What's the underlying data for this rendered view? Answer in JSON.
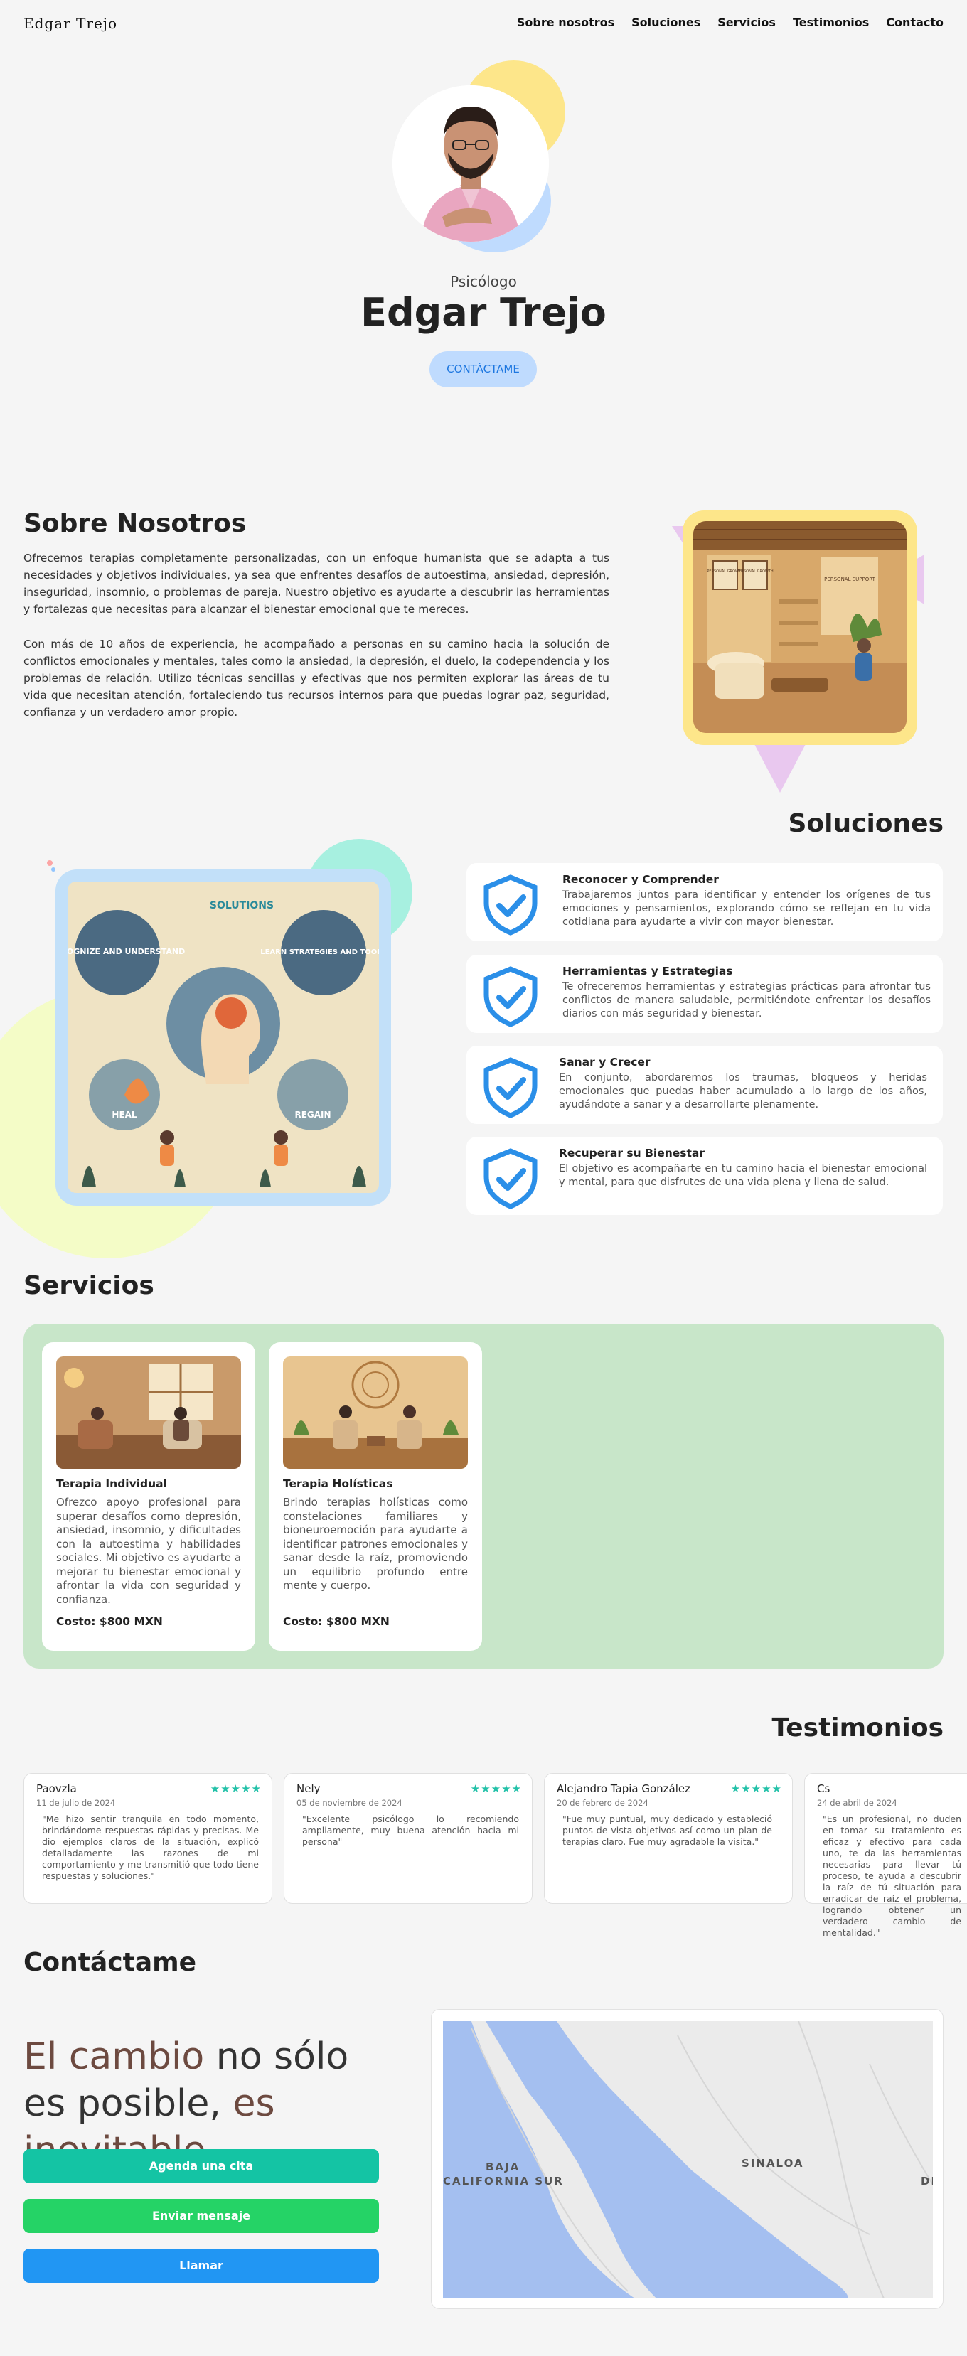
{
  "nav": {
    "brand": "Edgar Trejo",
    "links": [
      "Sobre nosotros",
      "Soluciones",
      "Servicios",
      "Testimonios",
      "Contacto"
    ]
  },
  "hero": {
    "role": "Psicólogo",
    "name": "Edgar Trejo",
    "cta": "CONTÁCTAME"
  },
  "about": {
    "title": "Sobre Nosotros",
    "p1": "Ofrecemos terapias completamente personalizadas, con un enfoque humanista que se adapta a tus necesidades y objetivos individuales, ya sea que enfrentes desafíos de autoestima, ansiedad, depresión, inseguridad, insomnio, o problemas de pareja. Nuestro objetivo es ayudarte a descubrir las herramientas y fortalezas que necesitas para alcanzar el bienestar emocional que te mereces.",
    "p2": "Con más de 10 años de experiencia, he acompañado a personas en su camino hacia la solución de conflictos emocionales y mentales, tales como la ansiedad, la depresión, el duelo, la codependencia y los problemas de relación. Utilizo técnicas sencillas y efectivas que nos permiten explorar las áreas de tu vida que necesitan atención, fortaleciendo tus recursos internos para que puedas lograr paz, seguridad, confianza y un verdadero amor propio.",
    "image_signs": [
      "PERSONAL GROWTH",
      "PERSONAL GROWTH",
      "PERSONAL SUPPORT"
    ]
  },
  "solutions": {
    "title": "Soluciones",
    "image_labels": {
      "top": "SOLUTIONS",
      "left": "RECOGNIZE AND UNDERSTAND",
      "right": "LEARN STRATEGIES AND TOOLS",
      "heal": "HEAL",
      "regain": "REGAIN"
    },
    "items": [
      {
        "title": "Reconocer y Comprender",
        "desc": "Trabajaremos juntos para identificar y entender los orígenes de tus emociones y pensamientos, explorando cómo se reflejan en tu vida cotidiana para ayudarte a vivir con mayor bienestar."
      },
      {
        "title": "Herramientas y Estrategias",
        "desc": "Te ofreceremos herramientas y estrategias prácticas para afrontar tus conflictos de manera saludable, permitiéndote enfrentar los desafíos diarios con más seguridad y bienestar."
      },
      {
        "title": "Sanar y Crecer",
        "desc": "En conjunto, abordaremos los traumas, bloqueos y heridas emocionales que puedas haber acumulado a lo largo de los años, ayudándote a sanar y a desarrollarte plenamente."
      },
      {
        "title": "Recuperar su Bienestar",
        "desc": "El objetivo es acompañarte en tu camino hacia el bienestar emocional y mental, para que disfrutes de una vida plena y llena de salud."
      }
    ]
  },
  "services": {
    "title": "Servicios",
    "items": [
      {
        "title": "Terapia Individual",
        "desc": "Ofrezco apoyo profesional para superar desafíos como depresión, ansiedad, insomnio, y dificultades con la autoestima y habilidades sociales. Mi objetivo es ayudarte a mejorar tu bienestar emocional y afrontar la vida con seguridad y confianza.",
        "price": "Costo: $800 MXN"
      },
      {
        "title": "Terapia Holísticas",
        "desc": "Brindo terapias holísticas como constelaciones familiares y bioneuroemoción para ayudarte a identificar patrones emocionales y sanar desde la raíz, promoviendo un equilibrio profundo entre mente y cuerpo.",
        "price": "Costo: $800 MXN"
      }
    ]
  },
  "testimonials": {
    "title": "Testimonios",
    "items": [
      {
        "name": "Paovzla",
        "date": "11 de julio de 2024",
        "stars": "★★★★★",
        "text": "\"Me hizo sentir tranquila en todo momento, brindándome respuestas rápidas y precisas. Me dio ejemplos claros de la situación, explicó detalladamente las razones de mi comportamiento y me transmitió que todo tiene respuestas y soluciones.\""
      },
      {
        "name": "Nely",
        "date": "05 de noviembre de 2024",
        "stars": "★★★★★",
        "text": "\"Excelente psicólogo lo recomiendo ampliamente, muy buena atención hacia mi persona\""
      },
      {
        "name": "Alejandro Tapia González",
        "date": "20 de febrero de 2024",
        "stars": "★★★★★",
        "text": "\"Fue muy puntual, muy dedicado y estableció puntos de vista objetivos así como un plan de terapias claro. Fue muy agradable la visita.\""
      },
      {
        "name": "Cs",
        "date": "24 de abril de 2024",
        "stars": "★★★★★",
        "text": "\"Es un profesional, no duden en tomar su tratamiento es eficaz y efectivo para cada uno, te da las herramientas necesarias para llevar tú proceso, te ayuda a descubrir la raíz de tú situación para erradicar de raíz el problema, logrando obtener un verdadero cambio de mentalidad.\""
      }
    ]
  },
  "contact": {
    "title": "Contáctame",
    "quote": {
      "part1": "El cambio",
      "part2": " no sólo es posible, ",
      "part3": "es inevitable."
    },
    "buttons": [
      {
        "label": "Agenda una cita",
        "color": "#14c4a4"
      },
      {
        "label": "Enviar mensaje",
        "color": "#25d366"
      },
      {
        "label": "Llamar",
        "color": "#2196f3"
      }
    ],
    "map_labels": [
      "BAJA",
      "CALIFORNIA SUR",
      "SINALOA",
      "DI"
    ]
  },
  "colors": {
    "accent_blue": "#1d77e0",
    "shield_blue": "#2b8fe8",
    "star_teal": "#22c1a8",
    "services_bg": "#c8e6c9",
    "quote_brown": "#6d4a40"
  }
}
